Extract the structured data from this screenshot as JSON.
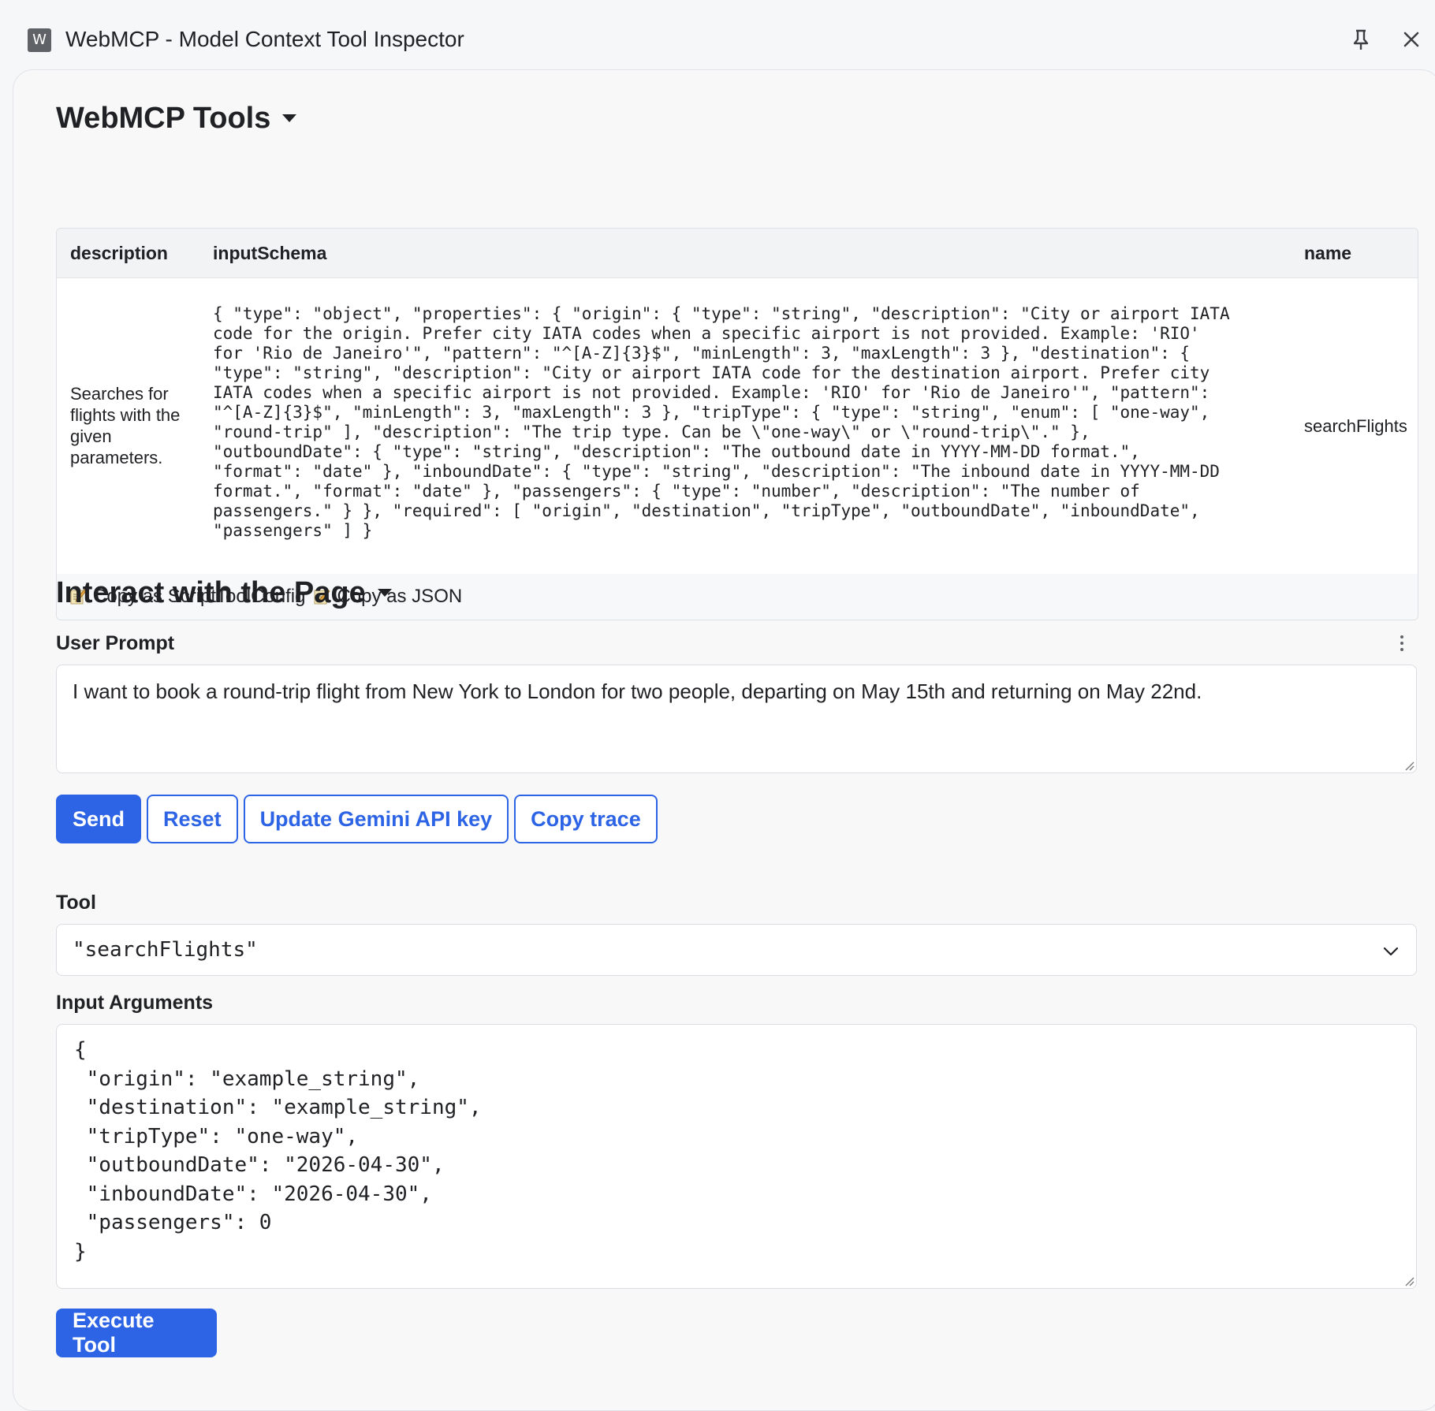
{
  "window": {
    "icon_letter": "W",
    "title": "WebMCP - Model Context Tool Inspector"
  },
  "tools_section": {
    "title": "WebMCP Tools",
    "columns": [
      "description",
      "inputSchema",
      "name"
    ],
    "rows": [
      {
        "description": "Searches for flights with the given parameters.",
        "inputSchema": "{ \"type\": \"object\", \"properties\": { \"origin\": { \"type\": \"string\", \"description\": \"City or airport IATA\ncode for the origin. Prefer city IATA codes when a specific airport is not provided. Example: 'RIO'\nfor 'Rio de Janeiro'\", \"pattern\": \"^[A-Z]{3}$\", \"minLength\": 3, \"maxLength\": 3 }, \"destination\": {\n\"type\": \"string\", \"description\": \"City or airport IATA code for the destination airport. Prefer city\nIATA codes when a specific airport is not provided. Example: 'RIO' for 'Rio de Janeiro'\", \"pattern\":\n\"^[A-Z]{3}$\", \"minLength\": 3, \"maxLength\": 3 }, \"tripType\": { \"type\": \"string\", \"enum\": [ \"one-way\",\n\"round-trip\" ], \"description\": \"The trip type. Can be \\\"one-way\\\" or \\\"round-trip\\\".\" },\n\"outboundDate\": { \"type\": \"string\", \"description\": \"The outbound date in YYYY-MM-DD format.\",\n\"format\": \"date\" }, \"inboundDate\": { \"type\": \"string\", \"description\": \"The inbound date in YYYY-MM-DD\nformat.\", \"format\": \"date\" }, \"passengers\": { \"type\": \"number\", \"description\": \"The number of\npassengers.\" } }, \"required\": [ \"origin\", \"destination\", \"tripType\", \"outboundDate\", \"inboundDate\",\n\"passengers\" ] }",
        "name": "searchFlights"
      }
    ],
    "copy_script_label": "Copy as ScriptToolConfig",
    "copy_json_label": "Copy as JSON"
  },
  "interact_section": {
    "title": "Interact with the Page",
    "user_prompt_label": "User Prompt",
    "user_prompt_value": "I want to book a round-trip flight from New York to London for two people, departing on May 15th and returning on May 22nd.",
    "buttons": {
      "send": "Send",
      "reset": "Reset",
      "update_key": "Update Gemini API key",
      "copy_trace": "Copy trace"
    },
    "tool_label": "Tool",
    "tool_selected": "\"searchFlights\"",
    "input_args_label": "Input Arguments",
    "input_args_value": "{\n \"origin\": \"example_string\",\n \"destination\": \"example_string\",\n \"tripType\": \"one-way\",\n \"outboundDate\": \"2026-04-30\",\n \"inboundDate\": \"2026-04-30\",\n \"passengers\": 0\n}",
    "execute_label": "Execute Tool"
  },
  "icons": {
    "app": "app-icon",
    "pin": "pin-icon",
    "close": "close-icon",
    "section_caret": "caret-down-icon",
    "memo": "memo-icon",
    "more": "more-vertical-icon",
    "select_chevron": "chevron-down-icon"
  },
  "colors": {
    "accent": "#2d64e6",
    "panel_bg": "#f8f8f8",
    "page_bg": "#f6f7f9"
  }
}
